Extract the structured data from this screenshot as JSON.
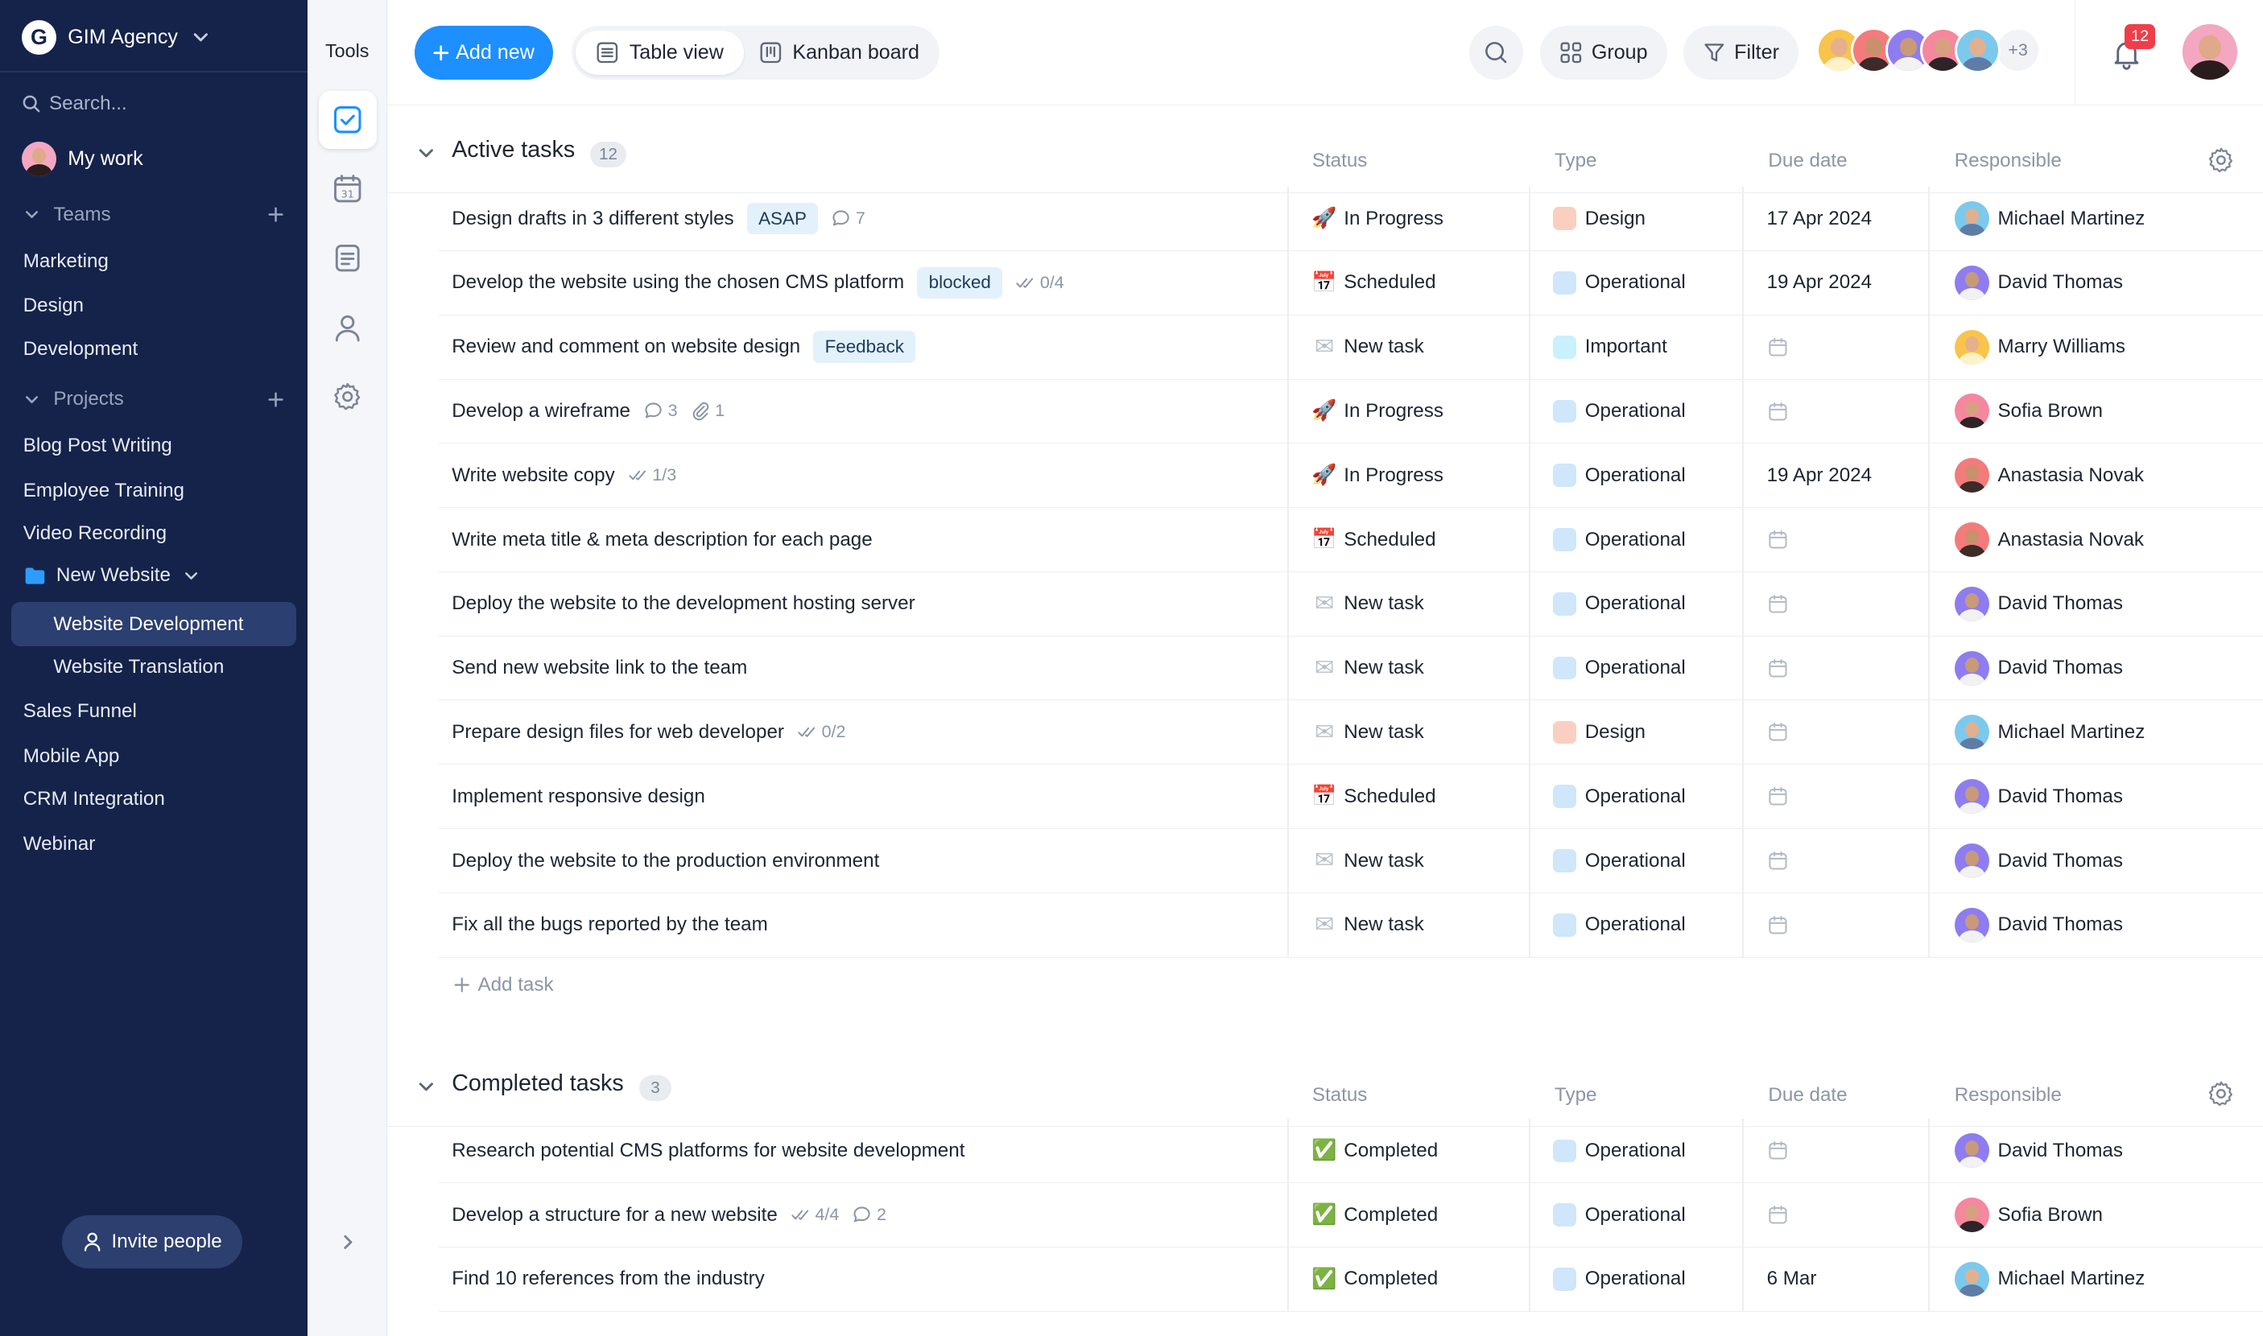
{
  "workspace": {
    "name": "GIM Agency",
    "logo_letter": "G"
  },
  "sidebar": {
    "search_placeholder": "Search...",
    "my_work": "My work",
    "teams_label": "Teams",
    "teams": [
      "Marketing",
      "Design",
      "Development"
    ],
    "projects_label": "Projects",
    "projects": [
      "Blog Post Writing",
      "Employee Training",
      "Video Recording"
    ],
    "folder": "New Website",
    "folder_items": [
      "Website Development",
      "Website Translation"
    ],
    "projects_after": [
      "Sales Funnel",
      "Mobile App",
      "CRM Integration",
      "Webinar"
    ],
    "invite": "Invite people"
  },
  "tools": {
    "title": "Tools"
  },
  "topbar": {
    "add_new": "Add new",
    "views": [
      "Table view",
      "Kanban board"
    ],
    "group": "Group",
    "filter": "Filter",
    "more_members": "+3",
    "notifications": "12"
  },
  "columns": {
    "status": "Status",
    "type": "Type",
    "due": "Due date",
    "responsible": "Responsible"
  },
  "colors": {
    "accent": "#1e8fff",
    "sidebar": "#15234a",
    "design": "#fbcfbf",
    "operational": "#cfe6fb",
    "important": "#c9f1fb"
  },
  "active": {
    "title": "Active tasks",
    "count": "12",
    "add_task": "Add task",
    "rows": [
      {
        "name": "Design drafts in 3 different styles",
        "tag": "ASAP",
        "comments": "7",
        "status_icon": "🚀",
        "status": "In Progress",
        "type": "Design",
        "due": "17 Apr 2024",
        "resp": "Michael Martinez"
      },
      {
        "name": "Develop the website using the chosen CMS platform",
        "tag": "blocked",
        "checklist": "0/4",
        "status_icon": "📅",
        "status": "Scheduled",
        "type": "Operational",
        "due": "19 Apr 2024",
        "resp": "David Thomas"
      },
      {
        "name": "Review and comment on website design",
        "tag": "Feedback",
        "status_icon": "✉",
        "status": "New task",
        "type": "Important",
        "due": "",
        "resp": "Marry Williams"
      },
      {
        "name": "Develop a wireframe",
        "comments": "3",
        "attachments": "1",
        "status_icon": "🚀",
        "status": "In Progress",
        "type": "Operational",
        "due": "",
        "resp": "Sofia Brown"
      },
      {
        "name": "Write website copy",
        "checklist": "1/3",
        "status_icon": "🚀",
        "status": "In Progress",
        "type": "Operational",
        "due": "19 Apr 2024",
        "resp": "Anastasia Novak"
      },
      {
        "name": "Write meta title & meta description for each page",
        "status_icon": "📅",
        "status": "Scheduled",
        "type": "Operational",
        "due": "",
        "resp": "Anastasia Novak"
      },
      {
        "name": "Deploy the website to the development hosting server",
        "status_icon": "✉",
        "status": "New task",
        "type": "Operational",
        "due": "",
        "resp": "David Thomas"
      },
      {
        "name": "Send new website link to the team",
        "status_icon": "✉",
        "status": "New task",
        "type": "Operational",
        "due": "",
        "resp": "David Thomas"
      },
      {
        "name": "Prepare design files for web developer",
        "checklist": "0/2",
        "status_icon": "✉",
        "status": "New task",
        "type": "Design",
        "due": "",
        "resp": "Michael Martinez"
      },
      {
        "name": "Implement responsive design",
        "status_icon": "📅",
        "status": "Scheduled",
        "type": "Operational",
        "due": "",
        "resp": "David Thomas"
      },
      {
        "name": "Deploy the website to the production environment",
        "status_icon": "✉",
        "status": "New task",
        "type": "Operational",
        "due": "",
        "resp": "David Thomas"
      },
      {
        "name": "Fix all the bugs reported by the team",
        "status_icon": "✉",
        "status": "New task",
        "type": "Operational",
        "due": "",
        "resp": "David Thomas"
      }
    ]
  },
  "completed": {
    "title": "Completed tasks",
    "count": "3",
    "rows": [
      {
        "name": "Research potential CMS platforms for website development",
        "status_icon": "✅",
        "status": "Completed",
        "type": "Operational",
        "due": "",
        "resp": "David Thomas"
      },
      {
        "name": "Develop a structure for a new website",
        "checklist": "4/4",
        "comments": "2",
        "status_icon": "✅",
        "status": "Completed",
        "type": "Operational",
        "due": "",
        "resp": "Sofia Brown"
      },
      {
        "name": "Find 10 references from the industry",
        "status_icon": "✅",
        "status": "Completed",
        "type": "Operational",
        "due": "6 Mar",
        "resp": "Michael Martinez"
      }
    ]
  }
}
